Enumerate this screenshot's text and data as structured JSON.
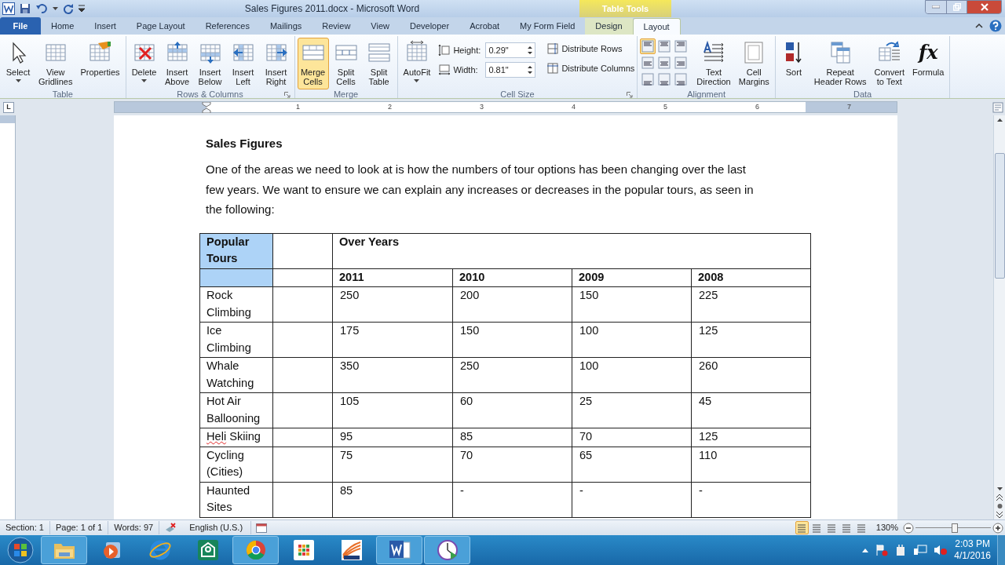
{
  "title_bar": {
    "title": "Sales Figures 2011.docx  -  Microsoft Word",
    "contextual_group": "Table Tools"
  },
  "tabs": [
    {
      "label": "File",
      "selected": false,
      "kind": "file"
    },
    {
      "label": "Home",
      "selected": false,
      "kind": "normal"
    },
    {
      "label": "Insert",
      "selected": false,
      "kind": "normal"
    },
    {
      "label": "Page Layout",
      "selected": false,
      "kind": "normal"
    },
    {
      "label": "References",
      "selected": false,
      "kind": "normal"
    },
    {
      "label": "Mailings",
      "selected": false,
      "kind": "normal"
    },
    {
      "label": "Review",
      "selected": false,
      "kind": "normal"
    },
    {
      "label": "View",
      "selected": false,
      "kind": "normal"
    },
    {
      "label": "Developer",
      "selected": false,
      "kind": "normal"
    },
    {
      "label": "Acrobat",
      "selected": false,
      "kind": "normal"
    },
    {
      "label": "My Form Field",
      "selected": false,
      "kind": "normal"
    },
    {
      "label": "Design",
      "selected": false,
      "kind": "contextual"
    },
    {
      "label": "Layout",
      "selected": true,
      "kind": "contextual"
    }
  ],
  "ribbon_groups": [
    {
      "label": "Table",
      "launcher": false,
      "items": [
        {
          "kind": "large",
          "lines": [
            "Select"
          ],
          "dropdown": true,
          "hovered": false
        },
        {
          "kind": "large",
          "lines": [
            "View",
            "Gridlines"
          ],
          "dropdown": false,
          "hovered": false
        },
        {
          "kind": "large",
          "lines": [
            "Properties"
          ],
          "dropdown": false,
          "hovered": false
        }
      ]
    },
    {
      "label": "Rows & Columns",
      "launcher": true,
      "items": [
        {
          "kind": "large",
          "lines": [
            "Delete"
          ],
          "dropdown": true,
          "hovered": false
        },
        {
          "kind": "large",
          "lines": [
            "Insert",
            "Above"
          ],
          "dropdown": false,
          "hovered": false
        },
        {
          "kind": "large",
          "lines": [
            "Insert",
            "Below"
          ],
          "dropdown": false,
          "hovered": false
        },
        {
          "kind": "large",
          "lines": [
            "Insert",
            "Left"
          ],
          "dropdown": false,
          "hovered": false
        },
        {
          "kind": "large",
          "lines": [
            "Insert",
            "Right"
          ],
          "dropdown": false,
          "hovered": false
        }
      ]
    },
    {
      "label": "Merge",
      "launcher": false,
      "items": [
        {
          "kind": "large",
          "lines": [
            "Merge",
            "Cells"
          ],
          "dropdown": false,
          "hovered": true
        },
        {
          "kind": "large",
          "lines": [
            "Split",
            "Cells"
          ],
          "dropdown": false,
          "hovered": false
        },
        {
          "kind": "large",
          "lines": [
            "Split",
            "Table"
          ],
          "dropdown": false,
          "hovered": false
        }
      ]
    },
    {
      "label": "Cell Size",
      "launcher": true,
      "items": [
        {
          "kind": "large",
          "lines": [
            "AutoFit"
          ],
          "dropdown": true,
          "hovered": false
        },
        {
          "kind": "size_fields",
          "fields": [
            {
              "label": "Height:",
              "value": "0.29\""
            },
            {
              "label": "Width:",
              "value": "0.81\""
            }
          ]
        },
        {
          "kind": "distribute",
          "buttons": [
            "Distribute Rows",
            "Distribute Columns"
          ]
        }
      ]
    },
    {
      "label": "Alignment",
      "launcher": false,
      "items": [
        {
          "kind": "align_grid",
          "cells": [
            {
              "selected": true
            },
            {
              "selected": false
            },
            {
              "selected": false
            },
            {
              "selected": false
            },
            {
              "selected": false
            },
            {
              "selected": false
            },
            {
              "selected": false
            },
            {
              "selected": false
            },
            {
              "selected": false
            }
          ]
        },
        {
          "kind": "large",
          "lines": [
            "Text",
            "Direction"
          ],
          "dropdown": false,
          "hovered": false
        },
        {
          "kind": "large",
          "lines": [
            "Cell",
            "Margins"
          ],
          "dropdown": false,
          "hovered": false
        }
      ]
    },
    {
      "label": "Data",
      "launcher": false,
      "items": [
        {
          "kind": "large",
          "lines": [
            "Sort"
          ],
          "dropdown": false,
          "hovered": false
        },
        {
          "kind": "large",
          "lines": [
            "Repeat",
            "Header Rows"
          ],
          "dropdown": false,
          "hovered": false
        },
        {
          "kind": "large",
          "lines": [
            "Convert",
            "to Text"
          ],
          "dropdown": false,
          "hovered": false
        },
        {
          "kind": "large",
          "glyph": "fx",
          "lines": [
            "Formula"
          ],
          "dropdown": false,
          "hovered": false
        }
      ]
    }
  ],
  "ruler": {
    "tab_selector": "L",
    "numbers": [
      "1",
      "2",
      "3",
      "4",
      "5",
      "6",
      "7"
    ]
  },
  "document": {
    "heading": "Sales Figures",
    "paragraph": "One of the areas we need to look at is how the numbers of tour options has been changing over the last few years. We want to ensure we can explain any increases or decreases in the popular tours, as seen in the following:",
    "table": {
      "header_rows": [
        {
          "cells": [
            {
              "text": "Popular Tours",
              "selected": true
            },
            {
              "selected": false
            },
            {
              "text": "Over Years",
              "selected": false
            }
          ]
        },
        {
          "cells": [
            {
              "selected": true
            },
            {
              "selected": false
            },
            {
              "text": "2011",
              "selected": false
            },
            {
              "text": "2010",
              "selected": false
            },
            {
              "text": "2009",
              "selected": false
            },
            {
              "text": "2008",
              "selected": false
            }
          ]
        }
      ],
      "rows": [
        {
          "tour": "Rock Climbing",
          "misspelled": false,
          "values": [
            "250",
            "200",
            "150",
            "225"
          ]
        },
        {
          "tour": "Ice Climbing",
          "misspelled": false,
          "values": [
            "175",
            "150",
            "100",
            "125"
          ]
        },
        {
          "tour": "Whale Watching",
          "misspelled": false,
          "values": [
            "350",
            "250",
            "100",
            "260"
          ]
        },
        {
          "tour": "Hot Air Ballooning",
          "misspelled": false,
          "values": [
            "105",
            "60",
            "25",
            "45"
          ]
        },
        {
          "tour": "Heli Skiing",
          "misspelled": true,
          "values": [
            "95",
            "85",
            "70",
            "125"
          ]
        },
        {
          "tour": "Cycling (Cities)",
          "misspelled": false,
          "values": [
            "75",
            "70",
            "65",
            "110"
          ]
        },
        {
          "tour": "Haunted Sites",
          "misspelled": false,
          "values": [
            "85",
            "-",
            "-",
            "-"
          ]
        }
      ]
    }
  },
  "status_bar": {
    "items": [
      "Section: 1",
      "Page: 1 of 1",
      "Words: 97"
    ],
    "language": "English (U.S.)",
    "views": [
      {
        "selected": true
      },
      {
        "selected": false
      },
      {
        "selected": false
      },
      {
        "selected": false
      },
      {
        "selected": false
      }
    ],
    "zoom": "130%",
    "zoom_level": {
      "level": 0.52
    }
  },
  "taskbar": {
    "apps": [
      {
        "running": true
      },
      {
        "running": false
      },
      {
        "running": false
      },
      {
        "running": false
      },
      {
        "running": true
      },
      {
        "running": false
      },
      {
        "running": false
      },
      {
        "running": true
      },
      {
        "running": true
      }
    ],
    "time": "2:03 PM",
    "date": "4/1/2016"
  }
}
